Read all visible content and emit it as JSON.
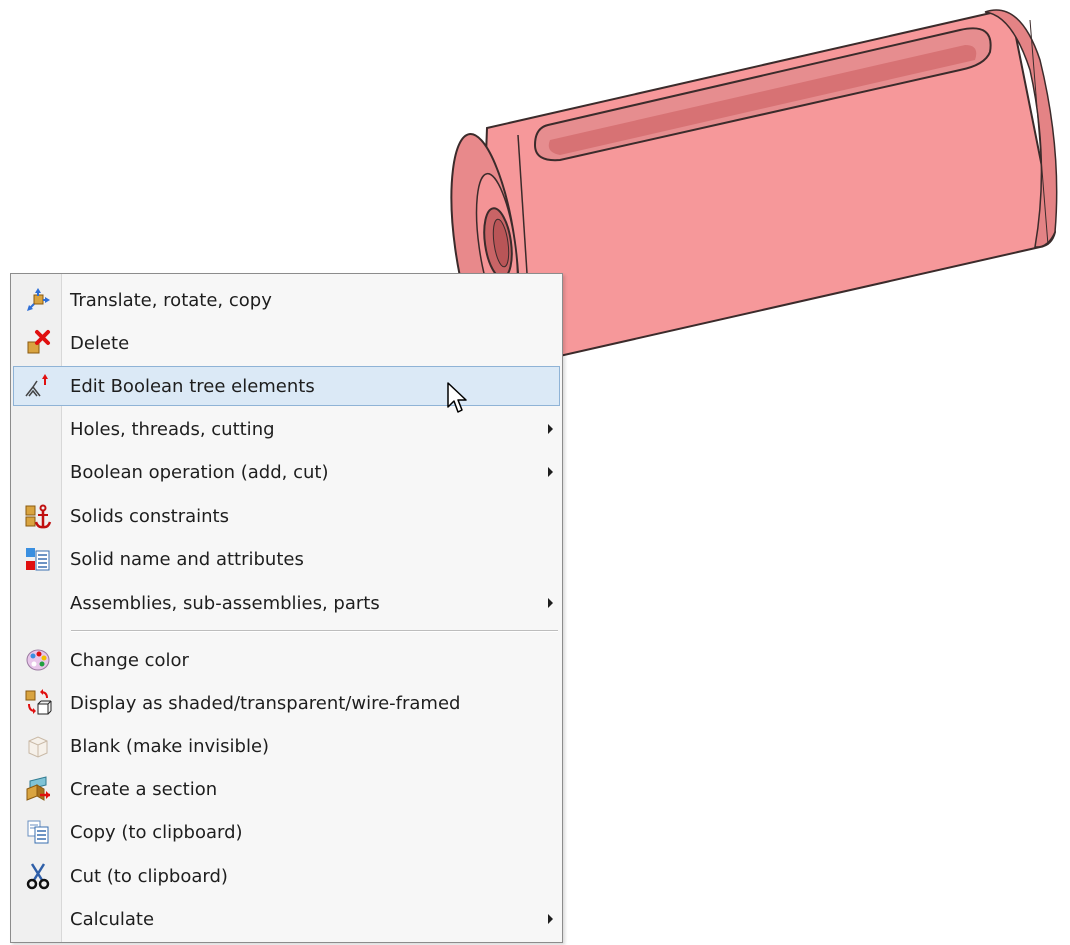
{
  "colors": {
    "part_fill": "#f6989a",
    "part_outline": "#3b2b2b",
    "menu_bg": "#f7f7f7",
    "hover_bg": "#dbe9f6",
    "hover_border": "#8fb3d6"
  },
  "context_menu": {
    "items": [
      {
        "label": "Translate, rotate, copy",
        "icon": "translate-icon",
        "submenu": false
      },
      {
        "label": "Delete",
        "icon": "delete-icon",
        "submenu": false
      },
      {
        "label": "Edit Boolean tree elements",
        "icon": "boolean-tree-icon",
        "submenu": false,
        "hovered": true
      },
      {
        "label": "Holes, threads, cutting",
        "icon": "",
        "submenu": true
      },
      {
        "label": "Boolean operation (add, cut)",
        "icon": "",
        "submenu": true
      },
      {
        "label": "Solids constraints",
        "icon": "anchor-icon",
        "submenu": false
      },
      {
        "label": "Solid name and attributes",
        "icon": "attributes-icon",
        "submenu": false
      },
      {
        "label": "Assemblies, sub-assemblies, parts",
        "icon": "",
        "submenu": true
      },
      {
        "label": "Change color",
        "icon": "palette-icon",
        "submenu": false
      },
      {
        "label": "Display as shaded/transparent/wire-framed",
        "icon": "display-mode-icon",
        "submenu": false
      },
      {
        "label": "Blank (make invisible)",
        "icon": "blank-icon",
        "submenu": false
      },
      {
        "label": "Create a section",
        "icon": "section-icon",
        "submenu": false
      },
      {
        "label": "Copy (to clipboard)",
        "icon": "copy-icon",
        "submenu": false
      },
      {
        "label": "Cut (to clipboard)",
        "icon": "scissors-icon",
        "submenu": false
      },
      {
        "label": "Calculate",
        "icon": "",
        "submenu": true
      }
    ]
  }
}
